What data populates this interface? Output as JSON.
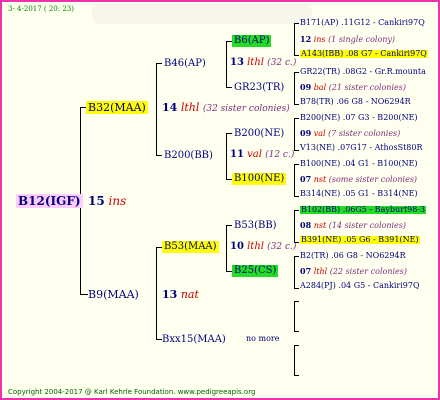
{
  "header": {
    "date": "3- 4-2017 ( 20: 23)"
  },
  "root": {
    "name": "B12(IGF)",
    "num": "15",
    "race": "ins"
  },
  "g1": {
    "top": {
      "name": "B32(MAA)",
      "num": "14",
      "race": "lthl",
      "note": "(32 sister colonies)"
    },
    "bot": {
      "name": "B9(MAA)",
      "num": "13",
      "race": "nat"
    }
  },
  "g2": {
    "a": {
      "name": "B46(AP)",
      "num": "13",
      "race": "lthl",
      "note": "(32 c.)"
    },
    "b": {
      "name": "B200(BB)",
      "num": "11",
      "race": "val",
      "note": "(12 c.)"
    },
    "c": {
      "name": "B53(MAA)",
      "num": "10",
      "race": "lthl",
      "note": "(32 c.)"
    },
    "d": {
      "name": "Bxx15(MAA)",
      "note": "no more"
    }
  },
  "g3": {
    "a": {
      "name": "B6(AP)"
    },
    "b": {
      "name": "GR23(TR)"
    },
    "c": {
      "name": "B200(NE)"
    },
    "d": {
      "name": "B100(NE)"
    },
    "e": {
      "name": "B53(BB)"
    },
    "f": {
      "name": "B25(CS)"
    }
  },
  "g4": [
    {
      "line": "B171(AP) .11G12 - Cankiri97Q"
    },
    {
      "num": "12",
      "race": "ins",
      "note": "(1 single colony)"
    },
    {
      "line": "A143(IBB) .08 G7 - Cankiri97Q"
    },
    {
      "line": "GR22(TR) .08G2 - Gr.R.mounta"
    },
    {
      "num": "09",
      "race": "bal",
      "note": "(21 sister colonies)"
    },
    {
      "line": "B78(TR) .06      G8 - NO6294R"
    },
    {
      "line": "B200(NE) .07   G3 - B200(NE)"
    },
    {
      "num": "09",
      "race": "val",
      "note": "(7 sister colonies)"
    },
    {
      "line": "V13(NE) .07G17 - AthosSt80R"
    },
    {
      "line": "B100(NE) .04   G1 - B100(NE)"
    },
    {
      "num": "07",
      "race": "nst",
      "note": "(some sister colonies)"
    },
    {
      "line": "B314(NE) .05   G1 - B314(NE)"
    },
    {
      "line": "B102(BB) .06G5 - Bayburt98-3"
    },
    {
      "num": "08",
      "race": "nst",
      "note": "(14 sister colonies)"
    },
    {
      "line": "B391(NE) .05   G6 - B391(NE)"
    },
    {
      "line": "B2(TR) .06        G8 - NO6294R"
    },
    {
      "num": "07",
      "race": "lthl",
      "note": "(22 sister colonies)"
    },
    {
      "line": "A284(PJ) .04  G5 - Cankiri97Q"
    }
  ],
  "footer": {
    "text": "Copyright 2004-2017 @ Karl Kehrle Foundation.   www.pedigreeapis.org"
  }
}
